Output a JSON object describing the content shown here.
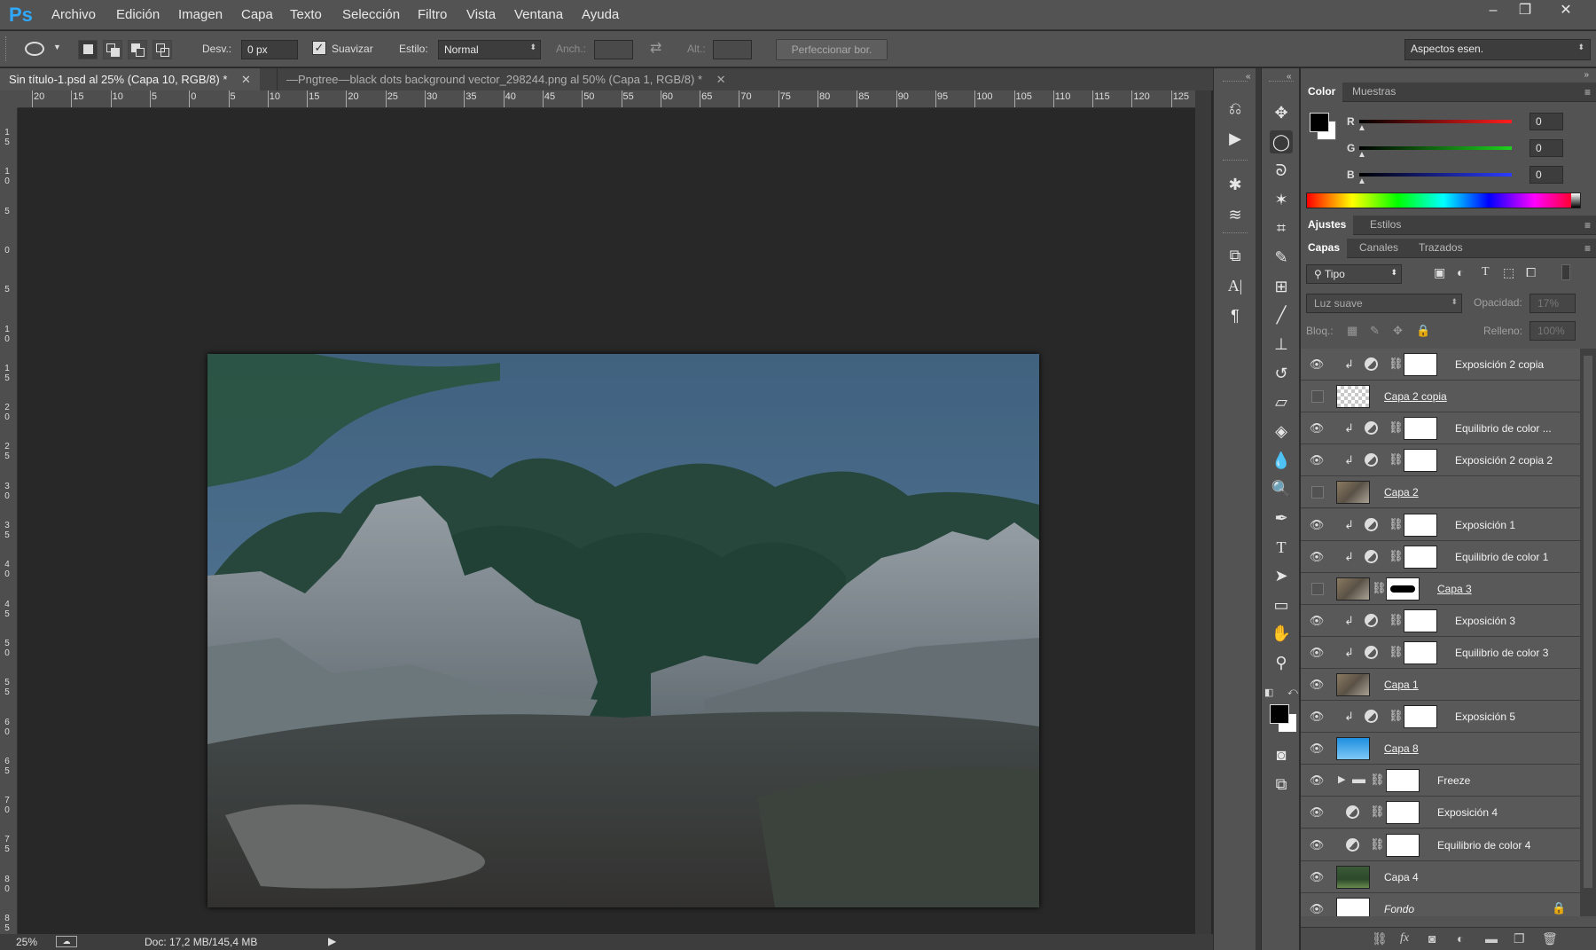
{
  "app": {
    "logo": "Ps"
  },
  "menu": [
    "Archivo",
    "Edición",
    "Imagen",
    "Capa",
    "Texto",
    "Selección",
    "Filtro",
    "Vista",
    "Ventana",
    "Ayuda"
  ],
  "window_controls": {
    "minimize": "–",
    "restore": "❐",
    "close": "✕"
  },
  "options": {
    "desv_label": "Desv.:",
    "desv_value": "0 px",
    "suavizar_label": "Suavizar",
    "suavizar_checked": true,
    "estilo_label": "Estilo:",
    "estilo_value": "Normal",
    "anch_label": "Anch.:",
    "alt_label": "Alt.:",
    "refine_button": "Perfeccionar bor.",
    "workspace": "Aspectos esen."
  },
  "tabs": [
    {
      "label": "Sin título-1.psd al 25% (Capa 10, RGB/8) *",
      "active": true
    },
    {
      "label": "—Pngtree—black dots background vector_298244.png al 50% (Capa 1, RGB/8) *",
      "active": false
    }
  ],
  "ruler_top": [
    "20",
    "15",
    "10",
    "5",
    "0",
    "5",
    "10",
    "15",
    "20",
    "25",
    "30",
    "35",
    "40",
    "45",
    "50",
    "55",
    "60",
    "65",
    "70",
    "75",
    "80",
    "85",
    "90",
    "95",
    "100",
    "105",
    "110",
    "115",
    "120",
    "125"
  ],
  "ruler_left": [
    "1 5",
    "1 0",
    "5",
    "0",
    "5",
    "1 0",
    "1 5",
    "2 0",
    "2 5",
    "3 0",
    "3 5",
    "4 0",
    "4 5",
    "5 0",
    "5 5",
    "6 0",
    "6 5",
    "7 0",
    "7 5",
    "8 0",
    "8 5"
  ],
  "status": {
    "zoom": "25%",
    "doc": "Doc: 17,2 MB/145,4 MB"
  },
  "color_panel": {
    "tabs": [
      "Color",
      "Muestras"
    ],
    "r_label": "R",
    "g_label": "G",
    "b_label": "B",
    "r": "0",
    "g": "0",
    "b": "0",
    "r_color": "#e02020",
    "g_color": "#20c020",
    "b_color": "#2040e0"
  },
  "adjust_panel": {
    "tabs": [
      "Ajustes",
      "Estilos"
    ]
  },
  "layers_panel": {
    "tabs": [
      "Capas",
      "Canales",
      "Trazados"
    ],
    "filter": "Tipo",
    "blend_mode": "Luz suave",
    "opacity_label": "Opacidad:",
    "opacity": "17%",
    "lock_label": "Bloq.:",
    "fill_label": "Relleno:",
    "fill": "100%",
    "layers": [
      {
        "name": "Exposición 2 copia",
        "visible": true,
        "kind": "adj",
        "clip": true
      },
      {
        "name": "Capa 2 copia",
        "visible": false,
        "kind": "pixel",
        "thumb": "checker"
      },
      {
        "name": "Equilibrio de color ...",
        "visible": true,
        "kind": "adj",
        "clip": true
      },
      {
        "name": "Exposición 2 copia 2",
        "visible": true,
        "kind": "adj",
        "clip": true
      },
      {
        "name": "Capa 2",
        "visible": false,
        "kind": "pixel",
        "thumb": "rock"
      },
      {
        "name": "Exposición 1",
        "visible": true,
        "kind": "adj",
        "clip": true
      },
      {
        "name": "Equilibrio de color 1",
        "visible": true,
        "kind": "adj",
        "clip": true
      },
      {
        "name": "Capa 3",
        "visible": false,
        "kind": "masked",
        "thumb": "rock"
      },
      {
        "name": "Exposición 3",
        "visible": true,
        "kind": "adj",
        "clip": true
      },
      {
        "name": "Equilibrio de color 3",
        "visible": true,
        "kind": "adj",
        "clip": true
      },
      {
        "name": "Capa 1",
        "visible": true,
        "kind": "pixel",
        "thumb": "rock"
      },
      {
        "name": "Exposición 5",
        "visible": true,
        "kind": "adj",
        "clip": true
      },
      {
        "name": "Capa 8",
        "visible": true,
        "kind": "pixel",
        "thumb": "sky"
      },
      {
        "name": "Freeze",
        "visible": true,
        "kind": "group"
      },
      {
        "name": "Exposición 4",
        "visible": true,
        "kind": "adj-ingroup"
      },
      {
        "name": "Equilibrio de color 4",
        "visible": true,
        "kind": "adj-ingroup"
      },
      {
        "name": "Capa 4",
        "visible": true,
        "kind": "pixel",
        "thumb": "forest"
      },
      {
        "name": "Fondo",
        "visible": true,
        "kind": "background",
        "thumb": "white"
      }
    ]
  }
}
